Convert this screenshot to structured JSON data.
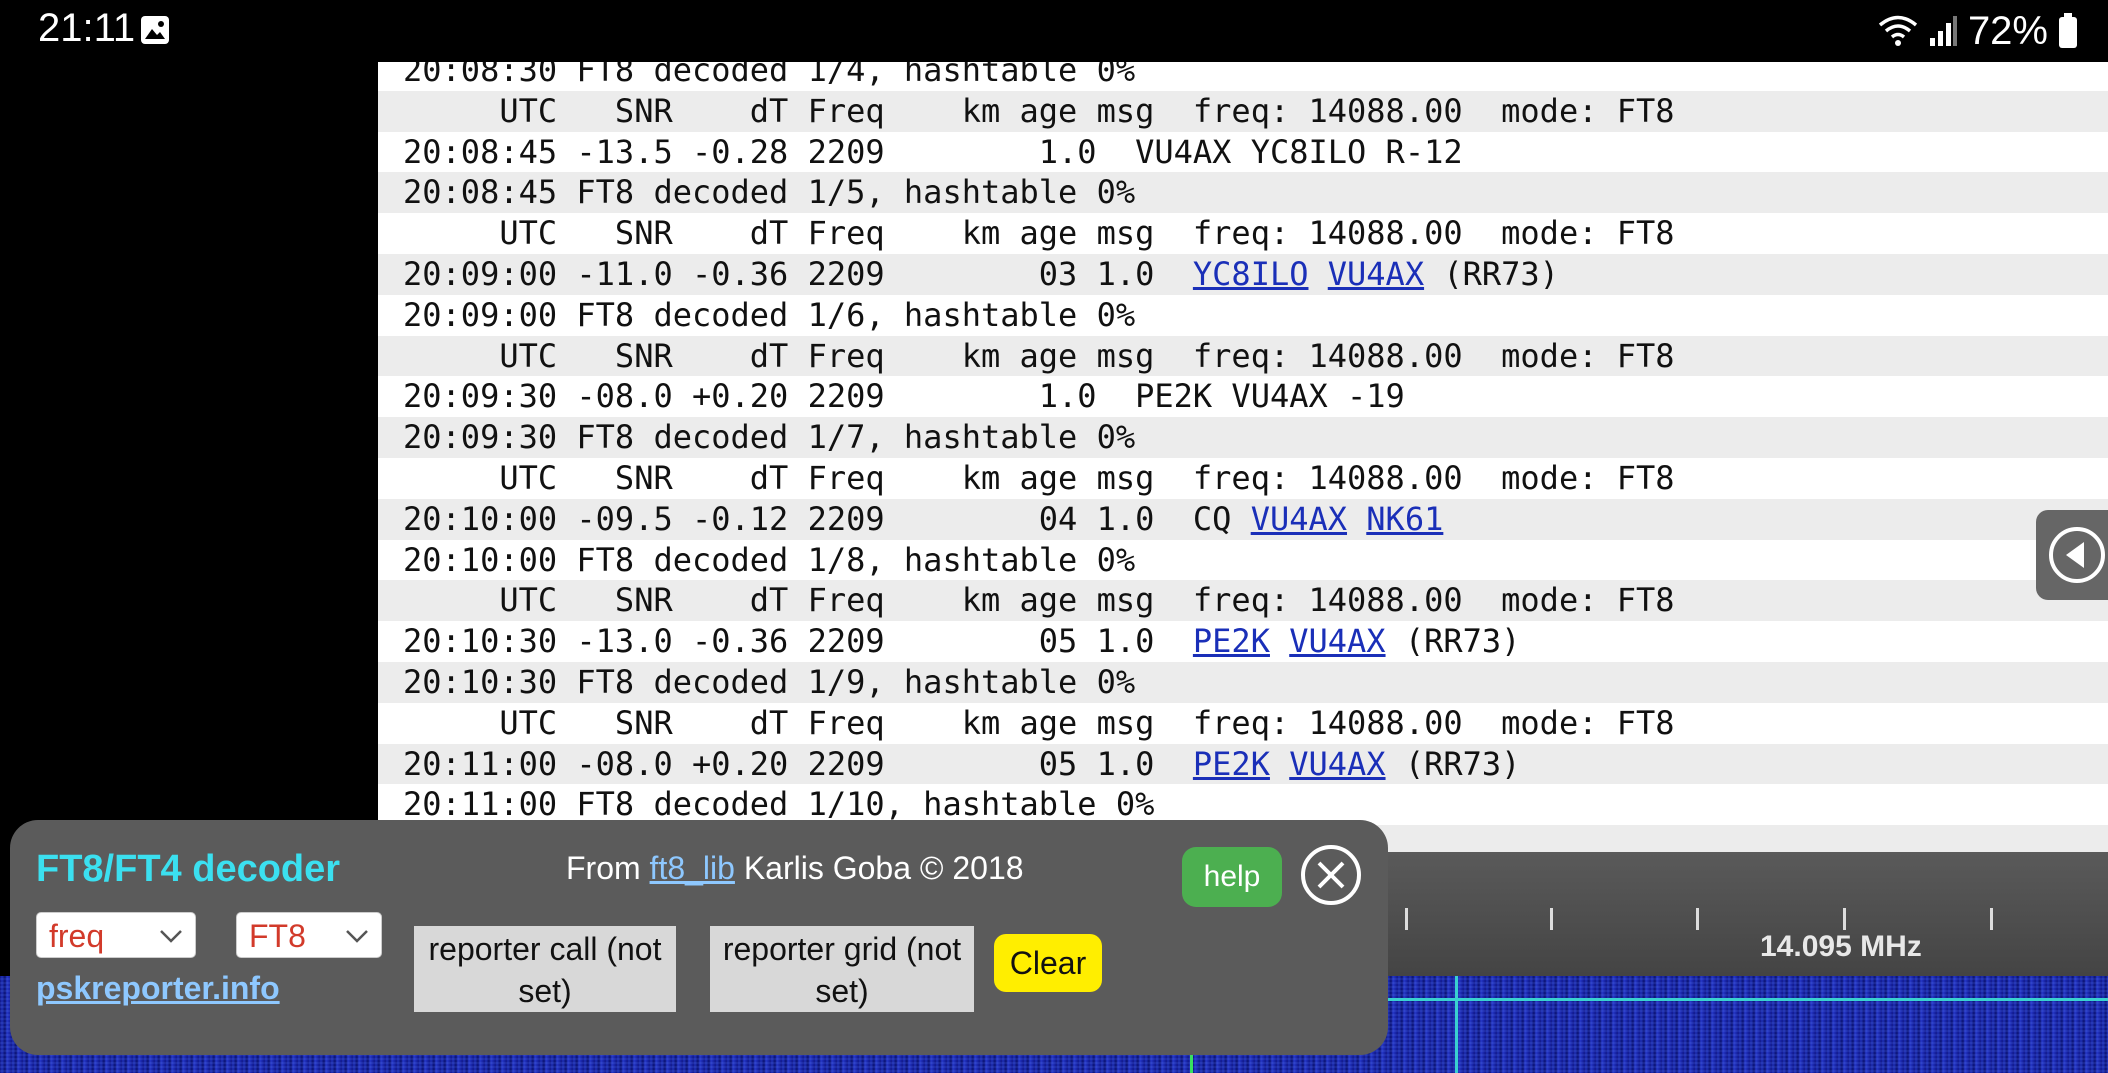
{
  "status_bar": {
    "time": "21:11",
    "battery": "72%",
    "icons": [
      "image-icon",
      "wifi-icon",
      "signal-icon",
      "battery-icon"
    ]
  },
  "log_rows": [
    {
      "text": "20:08:30 FT8 decoded 1/4, hashtable 0%",
      "alt": false
    },
    {
      "text": "     UTC   SNR    dT Freq    km age msg  freq: 14088.00  mode: FT8",
      "alt": true
    },
    {
      "text": "20:08:45 -13.5 -0.28 2209        1.0  VU4AX YC8ILO R-12",
      "alt": false
    },
    {
      "text": "20:08:45 FT8 decoded 1/5, hashtable 0%",
      "alt": true
    },
    {
      "text": "     UTC   SNR    dT Freq    km age msg  freq: 14088.00  mode: FT8",
      "alt": false
    },
    {
      "pre": "20:09:00 -11.0 -0.36 2209        03 1.0  ",
      "links": [
        "YC8ILO",
        "VU4AX"
      ],
      "post": " (RR73)",
      "alt": true
    },
    {
      "text": "20:09:00 FT8 decoded 1/6, hashtable 0%",
      "alt": false
    },
    {
      "text": "     UTC   SNR    dT Freq    km age msg  freq: 14088.00  mode: FT8",
      "alt": true
    },
    {
      "text": "20:09:30 -08.0 +0.20 2209        1.0  PE2K VU4AX -19",
      "alt": false
    },
    {
      "text": "20:09:30 FT8 decoded 1/7, hashtable 0%",
      "alt": true
    },
    {
      "text": "     UTC   SNR    dT Freq    km age msg  freq: 14088.00  mode: FT8",
      "alt": false
    },
    {
      "pre": "20:10:00 -09.5 -0.12 2209        04 1.0  CQ ",
      "links": [
        "VU4AX",
        "NK61"
      ],
      "post": "",
      "alt": true
    },
    {
      "text": "20:10:00 FT8 decoded 1/8, hashtable 0%",
      "alt": false
    },
    {
      "text": "     UTC   SNR    dT Freq    km age msg  freq: 14088.00  mode: FT8",
      "alt": true
    },
    {
      "pre": "20:10:30 -13.0 -0.36 2209        05 1.0  ",
      "links": [
        "PE2K",
        "VU4AX"
      ],
      "post": " (RR73)",
      "alt": false
    },
    {
      "text": "20:10:30 FT8 decoded 1/9, hashtable 0%",
      "alt": true
    },
    {
      "text": "     UTC   SNR    dT Freq    km age msg  freq: 14088.00  mode: FT8",
      "alt": false
    },
    {
      "pre": "20:11:00 -08.0 +0.20 2209        05 1.0  ",
      "links": [
        "PE2K",
        "VU4AX"
      ],
      "post": " (RR73)",
      "alt": true
    },
    {
      "text": "20:11:00 FT8 decoded 1/10, hashtable 0%",
      "alt": false
    },
    {
      "text": "",
      "alt": true
    }
  ],
  "waterfall": {
    "freq_label": "14.095 MHz"
  },
  "panel": {
    "title": "FT8/FT4 decoder",
    "from_prefix": "From ",
    "from_link": "ft8_lib",
    "from_suffix": " Karlis Goba © 2018",
    "help_label": "help",
    "select_sort": "freq",
    "select_mode": "FT8",
    "reporter_call": "reporter call (not set)",
    "reporter_grid": "reporter grid (not set)",
    "clear_label": "Clear",
    "psk_link": "pskreporter.info"
  }
}
